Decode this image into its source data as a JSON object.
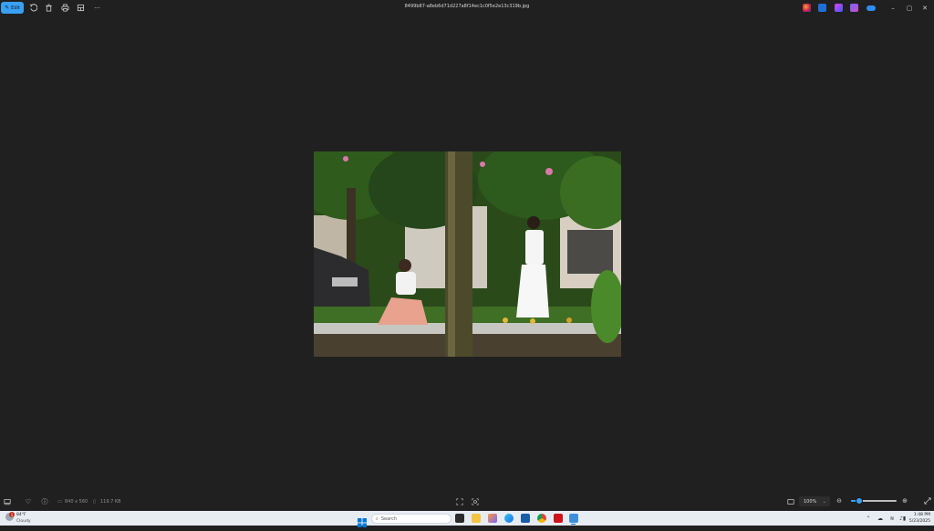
{
  "window": {
    "title": "8499b87-a8eb6d71d227a8f14ec1c0f5e2e13c319b.jpg",
    "edit_label": "Edit"
  },
  "toolbar": {
    "icons": [
      "rotate-icon",
      "delete-icon",
      "print-icon",
      "crop-icon",
      "more-icon"
    ],
    "more_label": "···"
  },
  "window_controls": {
    "minimize": "–",
    "maximize": "▢",
    "close": "✕"
  },
  "infobar": {
    "dimensions": "840 x 560",
    "file_size": "119.7 KB",
    "zoom_value": "100%",
    "zoom_level": 0.15
  },
  "taskbar": {
    "weather_temp": "84°F",
    "weather_condition": "Cloudy",
    "weather_badge": "1",
    "search_placeholder": "Search",
    "time": "1:48 PM",
    "date": "5/23/2025"
  },
  "colors": {
    "accent": "#3aa0f3",
    "background": "#202020",
    "taskbar": "#e7ecf3"
  }
}
